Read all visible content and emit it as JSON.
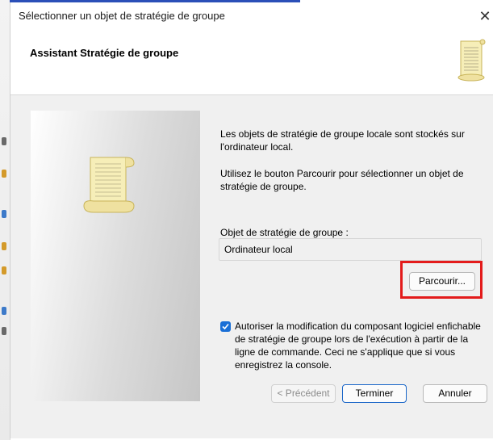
{
  "window": {
    "title": "Sélectionner un objet de stratégie de groupe",
    "close_symbol": "✕"
  },
  "header": {
    "title": "Assistant Stratégie de groupe",
    "icon": "scroll-icon"
  },
  "body": {
    "paragraph1": "Les objets de stratégie de groupe locale sont stockés sur l'ordinateur local.",
    "paragraph2": "Utilisez le bouton Parcourir pour sélectionner un objet de stratégie de groupe.",
    "field_label": "Objet de stratégie de groupe :",
    "field_value": "Ordinateur local",
    "browse_label": "Parcourir...",
    "checkbox_checked": true,
    "checkbox_label": "Autoriser la modification du composant logiciel enfichable de stratégie de groupe lors de l'exécution à partir de la ligne de commande. Ceci ne s'applique que si vous enregistrez la console."
  },
  "footer": {
    "prev_label": "< Précédent",
    "finish_label": "Terminer",
    "cancel_label": "Annuler"
  },
  "colors": {
    "highlight": "#e31b1b",
    "accent": "#1a6fd6",
    "scroll_paper": "#f6eeb8"
  }
}
